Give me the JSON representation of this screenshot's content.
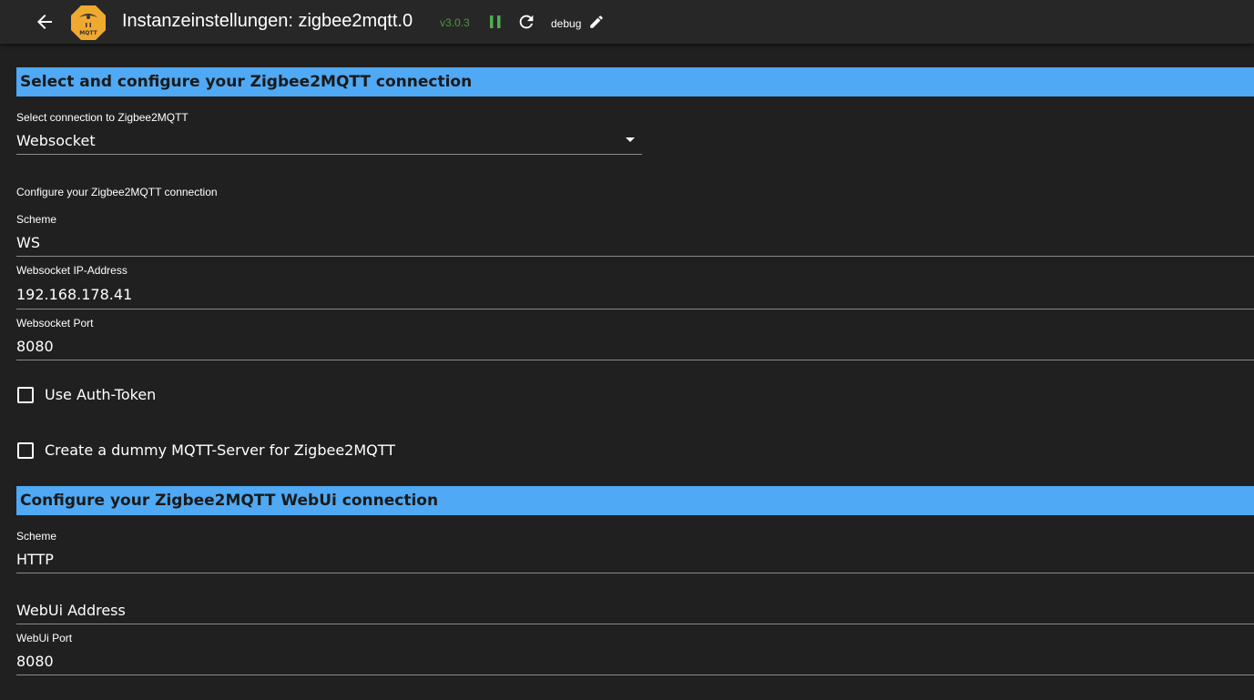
{
  "header": {
    "title": "Instanzeinstellungen: zigbee2mqtt.0",
    "version": "v3.0.3",
    "loglevel": "debug",
    "logo_text": "MQTT"
  },
  "colors": {
    "accent": "#4fa9f4",
    "version_green": "#4c9a3a",
    "pause_green": "#4caf50",
    "logo_bg": "#f0a92f"
  },
  "section1": {
    "title": "Select and configure your Zigbee2MQTT connection",
    "connection_select": {
      "label": "Select connection to Zigbee2MQTT",
      "value": "Websocket"
    },
    "info": "Configure your Zigbee2MQTT connection",
    "scheme": {
      "label": "Scheme",
      "value": "WS"
    },
    "ip": {
      "label": "Websocket IP-Address",
      "value": "192.168.178.41"
    },
    "port": {
      "label": "Websocket Port",
      "value": "8080"
    },
    "auth_token": {
      "label": "Use Auth-Token",
      "checked": false
    },
    "dummy_mqtt": {
      "label": "Create a dummy MQTT-Server for Zigbee2MQTT",
      "checked": false
    }
  },
  "section2": {
    "title": "Configure your Zigbee2MQTT WebUi connection",
    "scheme": {
      "label": "Scheme",
      "value": "HTTP"
    },
    "address": {
      "placeholder": "WebUi Address",
      "value": ""
    },
    "port": {
      "label": "WebUi Port",
      "value": "8080"
    }
  }
}
